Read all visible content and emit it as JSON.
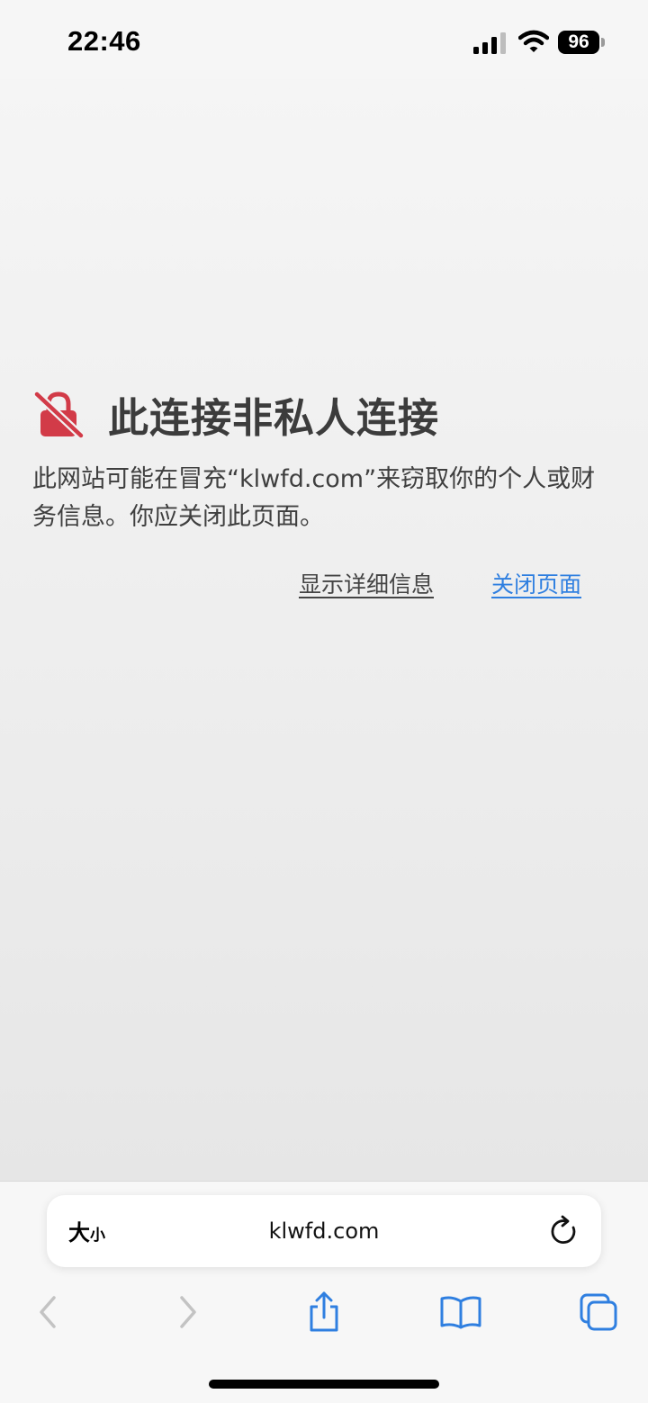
{
  "status_bar": {
    "time": "22:46",
    "battery": "96",
    "icons": [
      "cellular-signal-icon",
      "wifi-icon",
      "battery-icon"
    ]
  },
  "warning": {
    "title": "此连接非私人连接",
    "body": "此网站可能在冒充“klwfd.com”来窃取你的个人或财务信息。你应关闭此页面。",
    "show_details_label": "显示详细信息",
    "close_page_label": "关闭页面",
    "icon": "broken-lock-icon",
    "icon_color": "#d23b48",
    "link_color": "#2f7fe0"
  },
  "address_bar": {
    "text_size_label_big": "大",
    "text_size_label_small": "小",
    "url": "klwfd.com",
    "reload_icon": "reload-icon"
  },
  "toolbar": {
    "icons": [
      "back-icon",
      "forward-icon",
      "share-icon",
      "bookmarks-icon",
      "tabs-icon"
    ],
    "accent_color": "#2f7fe0"
  }
}
